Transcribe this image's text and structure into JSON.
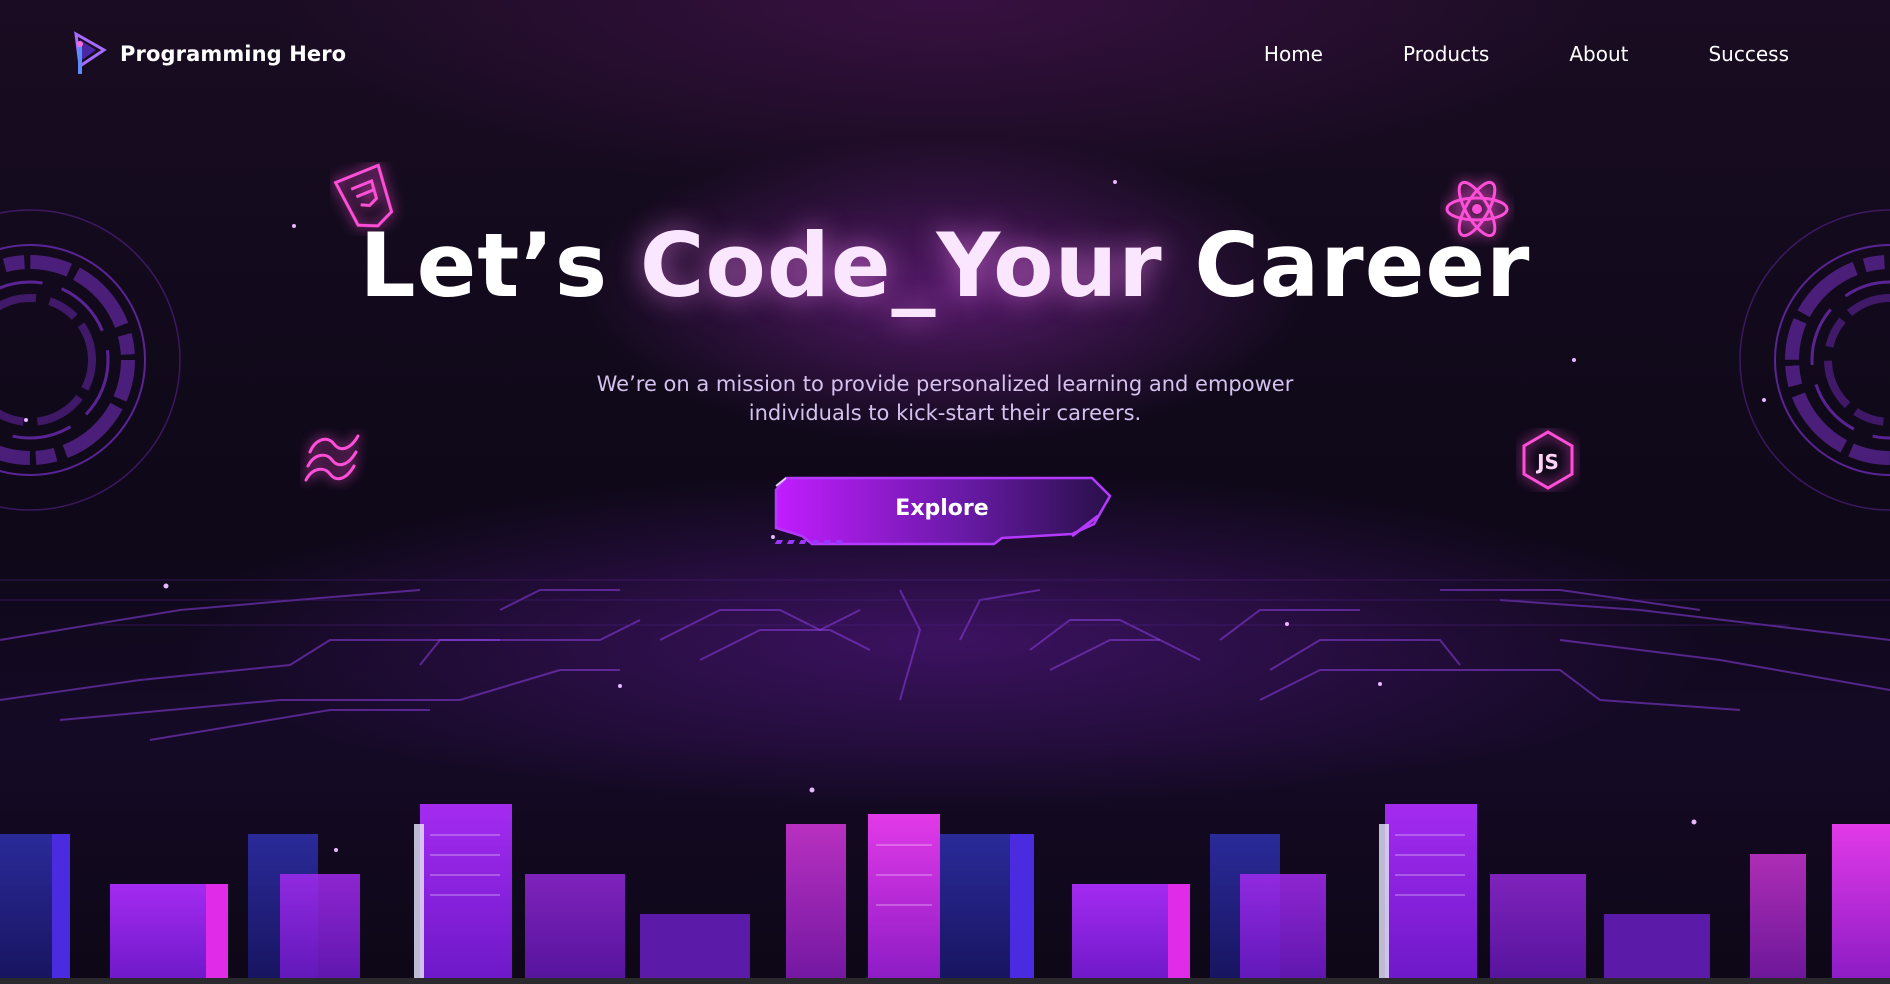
{
  "brand": {
    "name": "Programming Hero",
    "logo_icon": "play-logo-icon"
  },
  "nav": {
    "items": [
      {
        "label": "Home"
      },
      {
        "label": "Products"
      },
      {
        "label": "About"
      },
      {
        "label": "Success"
      }
    ]
  },
  "hero": {
    "title_part1": "Let’s ",
    "title_part2": "Code_Your",
    "title_part3": " Career",
    "subtitle_line1": "We’re on a mission to provide personalized learning and empower",
    "subtitle_line2": "individuals to kick-start their careers.",
    "cta_label": "Explore"
  },
  "floating_icons": [
    "css3-icon",
    "react-icon",
    "tailwind-icon",
    "nodejs-icon"
  ],
  "colors": {
    "accent": "#b21cf0",
    "accent_dark": "#4c0f7a",
    "neon_pink": "#ff4fd8",
    "background": "#0e0818",
    "subtitle": "#d4c1ee"
  }
}
